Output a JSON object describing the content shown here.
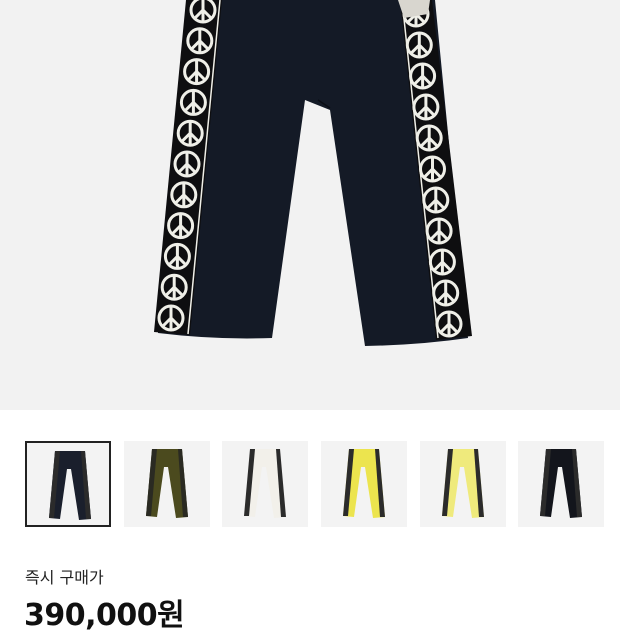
{
  "product": {
    "image_subject": "pants-photo",
    "colors": {
      "pants": "#141a26",
      "tape": "#0e0e10",
      "tape_print": "#efefe8",
      "background": "#f2f2f2"
    }
  },
  "thumbnails": [
    {
      "name": "thumb-navy",
      "body": "#1a1f2c",
      "tape": "#2b2b2b",
      "selected": true
    },
    {
      "name": "thumb-olive",
      "body": "#4b4a1e",
      "tape": "#2a2a22",
      "selected": false
    },
    {
      "name": "thumb-white",
      "body": "#f2f0ea",
      "tape": "#2b2b2b",
      "selected": false
    },
    {
      "name": "thumb-yellow",
      "body": "#ece44e",
      "tape": "#2b2b2b",
      "selected": false
    },
    {
      "name": "thumb-light-yellow",
      "body": "#efea7c",
      "tape": "#2b2b2b",
      "selected": false
    },
    {
      "name": "thumb-black",
      "body": "#13151c",
      "tape": "#2b2b2b",
      "selected": false
    }
  ],
  "pricing": {
    "label": "즉시 구매가",
    "price": "390,000원"
  }
}
